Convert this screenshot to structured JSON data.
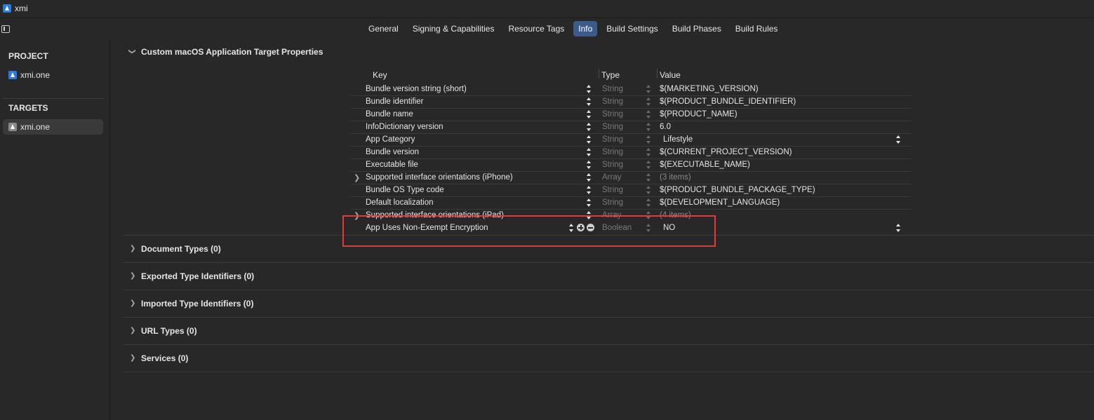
{
  "window": {
    "title": "xmi"
  },
  "tabs": [
    "General",
    "Signing & Capabilities",
    "Resource Tags",
    "Info",
    "Build Settings",
    "Build Phases",
    "Build Rules"
  ],
  "active_tab": "Info",
  "sidebar": {
    "project_header": "PROJECT",
    "project_item": "xmi.one",
    "targets_header": "TARGETS",
    "target_item": "xmi.one"
  },
  "section_main": "Custom macOS Application Target Properties",
  "table": {
    "col_key": "Key",
    "col_type": "Type",
    "col_value": "Value",
    "rows": [
      {
        "key": "Bundle version string (short)",
        "type": "String",
        "value": "$(MARKETING_VERSION)"
      },
      {
        "key": "Bundle identifier",
        "type": "String",
        "value": "$(PRODUCT_BUNDLE_IDENTIFIER)"
      },
      {
        "key": "Bundle name",
        "type": "String",
        "value": "$(PRODUCT_NAME)"
      },
      {
        "key": "InfoDictionary version",
        "type": "String",
        "value": "6.0"
      },
      {
        "key": "App Category",
        "type": "String",
        "value": "Lifestyle"
      },
      {
        "key": "Bundle version",
        "type": "String",
        "value": "$(CURRENT_PROJECT_VERSION)"
      },
      {
        "key": "Executable file",
        "type": "String",
        "value": "$(EXECUTABLE_NAME)"
      },
      {
        "key": "Supported interface orientations (iPhone)",
        "type": "Array",
        "value": "(3 items)"
      },
      {
        "key": "Bundle OS Type code",
        "type": "String",
        "value": "$(PRODUCT_BUNDLE_PACKAGE_TYPE)"
      },
      {
        "key": "Default localization",
        "type": "String",
        "value": "$(DEVELOPMENT_LANGUAGE)"
      },
      {
        "key": "Supported interface orientations (iPad)",
        "type": "Array",
        "value": "(4 items)"
      },
      {
        "key": "App Uses Non-Exempt Encryption",
        "type": "Boolean",
        "value": "NO"
      }
    ]
  },
  "sections": [
    "Document Types (0)",
    "Exported Type Identifiers (0)",
    "Imported Type Identifiers (0)",
    "URL Types (0)",
    "Services (0)"
  ],
  "colors": {
    "accent": "#3c5b8a",
    "highlight_box": "#e53935",
    "background": "#282828"
  }
}
